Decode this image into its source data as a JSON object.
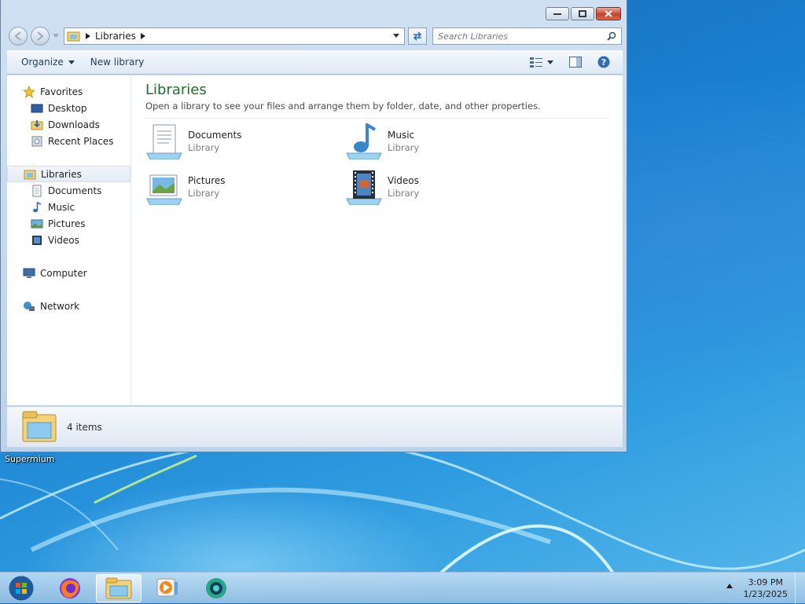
{
  "window": {
    "address": {
      "crumb": "Libraries"
    },
    "search": {
      "placeholder": "Search Libraries"
    },
    "toolbar": {
      "organize": "Organize",
      "new_library": "New library"
    }
  },
  "navigation_pane": {
    "favorites": {
      "label": "Favorites",
      "items": [
        "Desktop",
        "Downloads",
        "Recent Places"
      ]
    },
    "libraries": {
      "label": "Libraries",
      "items": [
        "Documents",
        "Music",
        "Pictures",
        "Videos"
      ]
    },
    "computer": "Computer",
    "network": "Network"
  },
  "content": {
    "title": "Libraries",
    "description": "Open a library to see your files and arrange them by folder, date, and other properties.",
    "libraries": [
      {
        "name": "Documents",
        "type": "Library",
        "icon": "documents-library-icon"
      },
      {
        "name": "Music",
        "type": "Library",
        "icon": "music-library-icon"
      },
      {
        "name": "Pictures",
        "type": "Library",
        "icon": "pictures-library-icon"
      },
      {
        "name": "Videos",
        "type": "Library",
        "icon": "videos-library-icon"
      }
    ]
  },
  "details_pane": {
    "item_count": "4 items"
  },
  "desktop": {
    "label": "Supermium"
  },
  "taskbar": {
    "time": "3:09 PM",
    "date": "1/23/2025"
  },
  "colors": {
    "title_green": "#1e6e2b",
    "close_red": "#c8412b",
    "desktop_blue": "#1a7fd0"
  }
}
